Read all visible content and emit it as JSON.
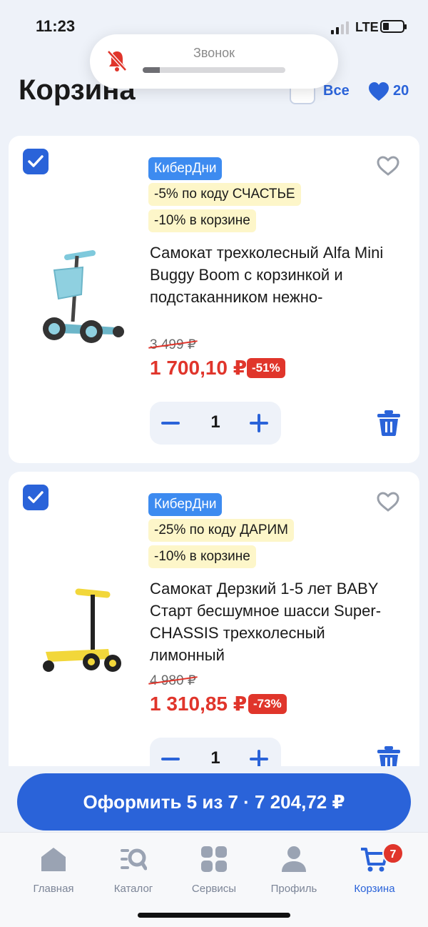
{
  "status_bar": {
    "time": "11:23",
    "network": "LTE",
    "battery_level": 0.2
  },
  "ringer_popup": {
    "label": "Звонок",
    "volume_level": 0.12,
    "icon": "bell-slash-icon"
  },
  "header": {
    "title": "Корзина",
    "select_all_label": "Все",
    "favorites_count": "20"
  },
  "cart_items": [
    {
      "checked": true,
      "promo_tag": "КиберДни",
      "code_offer": "-5% по коду СЧАСТЬЕ",
      "cart_offer": "-10% в корзине",
      "name": "Самокат трехколесный Alfa Mini Buggy Boom с корзинкой и подстаканником нежно-",
      "old_price": "3 499 ₽",
      "new_price": "1 700,10 ₽",
      "discount": "-51%",
      "quantity": "1",
      "image": "scooter-blue-image"
    },
    {
      "checked": true,
      "promo_tag": "КиберДни",
      "code_offer": "-25% по коду ДАРИМ",
      "cart_offer": "-10% в корзине",
      "name": "Самокат Дерзкий 1-5 лет BABY Старт бесшумное шасси Super-CHASSIS трехколесный лимонный",
      "old_price": "4 980 ₽",
      "new_price": "1 310,85 ₽",
      "discount": "-73%",
      "quantity": "1",
      "image": "scooter-yellow-image"
    }
  ],
  "checkout": {
    "label": "Оформить 5 из 7 · 7 204,72 ₽"
  },
  "tab_bar": {
    "tabs": [
      {
        "label": "Главная",
        "icon": "home-icon"
      },
      {
        "label": "Каталог",
        "icon": "catalog-search-icon"
      },
      {
        "label": "Сервисы",
        "icon": "services-grid-icon"
      },
      {
        "label": "Профиль",
        "icon": "profile-icon"
      },
      {
        "label": "Корзина",
        "icon": "cart-icon",
        "active": true,
        "badge": "7"
      }
    ]
  },
  "colors": {
    "accent": "#2a63d9",
    "sale": "#e0352b",
    "promo": "#3d8bf0",
    "offer_bg": "#fdf6c9"
  }
}
